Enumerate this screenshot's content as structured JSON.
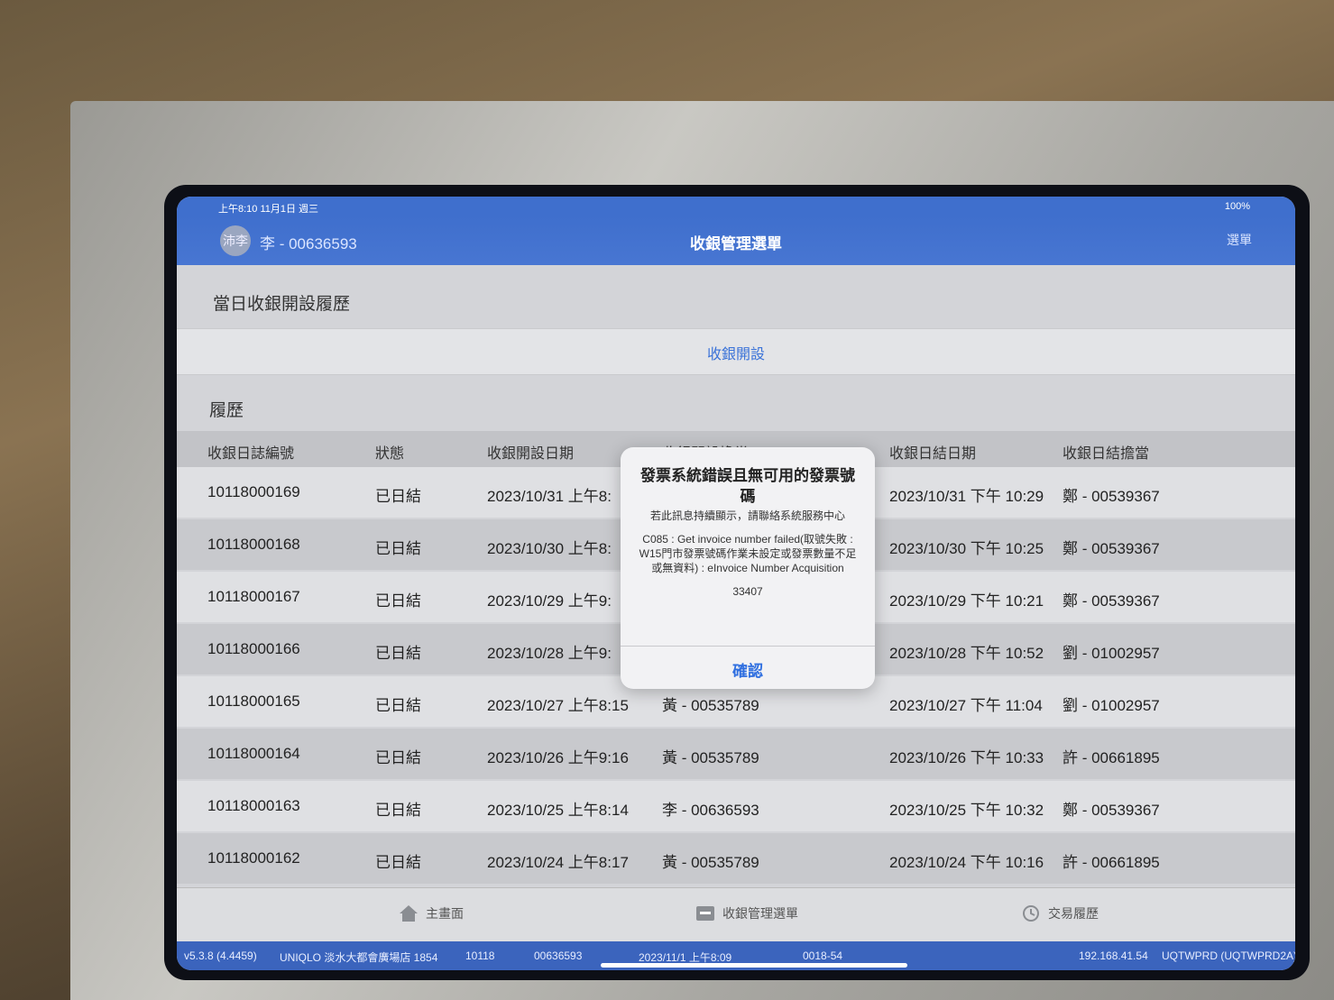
{
  "status": {
    "time": "上午8:10 11月1日 週三",
    "battery": "100%"
  },
  "nav": {
    "avatar": "沛李",
    "user": "李 - 00636593",
    "title": "收銀管理選單",
    "menu": "選單"
  },
  "section_title": "當日收銀開設履歷",
  "open_button": "收銀開設",
  "history_title": "履歷",
  "columns": [
    "收銀日誌編號",
    "狀態",
    "收銀開設日期",
    "收銀開設擔當",
    "收銀日結日期",
    "收銀日結擔當"
  ],
  "rows": [
    [
      "10118000169",
      "已日結",
      "2023/10/31 上午8:",
      "",
      "2023/10/31 下午 10:29",
      "鄭 - 00539367"
    ],
    [
      "10118000168",
      "已日結",
      "2023/10/30 上午8:",
      "",
      "2023/10/30 下午 10:25",
      "鄭 - 00539367"
    ],
    [
      "10118000167",
      "已日結",
      "2023/10/29 上午9:",
      "",
      "2023/10/29 下午 10:21",
      "鄭 - 00539367"
    ],
    [
      "10118000166",
      "已日結",
      "2023/10/28 上午9:",
      "",
      "2023/10/28 下午 10:52",
      "劉 - 01002957"
    ],
    [
      "10118000165",
      "已日結",
      "2023/10/27 上午8:15",
      "黃 - 00535789",
      "2023/10/27 下午 11:04",
      "劉 - 01002957"
    ],
    [
      "10118000164",
      "已日結",
      "2023/10/26 上午9:16",
      "黃 - 00535789",
      "2023/10/26 下午 10:33",
      "許 - 00661895"
    ],
    [
      "10118000163",
      "已日結",
      "2023/10/25 上午8:14",
      "李 - 00636593",
      "2023/10/25 下午 10:32",
      "鄭 - 00539367"
    ],
    [
      "10118000162",
      "已日結",
      "2023/10/24 上午8:17",
      "黃 - 00535789",
      "2023/10/24 下午 10:16",
      "許 - 00661895"
    ]
  ],
  "tabs": {
    "home": "主畫面",
    "cash_menu": "收銀管理選單",
    "history": "交易履歷"
  },
  "info_bar": {
    "version": "v5.3.8 (4.4459)",
    "store": "UNIQLO 淡水大都會廣場店 1854",
    "store_code": "10118",
    "staff": "00636593",
    "login": "2023/11/1 上午8:09",
    "register": "0018-54",
    "ip": "192.168.41.54",
    "env": "UQTWPRD (UQTWPRD2A)"
  },
  "alert": {
    "title": "發票系統錯誤且無可用的發票號碼",
    "line1": "若此訊息持續顯示，請聯絡系統服務中心",
    "line2": "C085 : Get invoice number failed(取號失敗 : W15門市發票號碼作業未設定或發票數量不足或無資料) : eInvoice Number Acquisition",
    "code": "33407",
    "confirm": "確認"
  }
}
